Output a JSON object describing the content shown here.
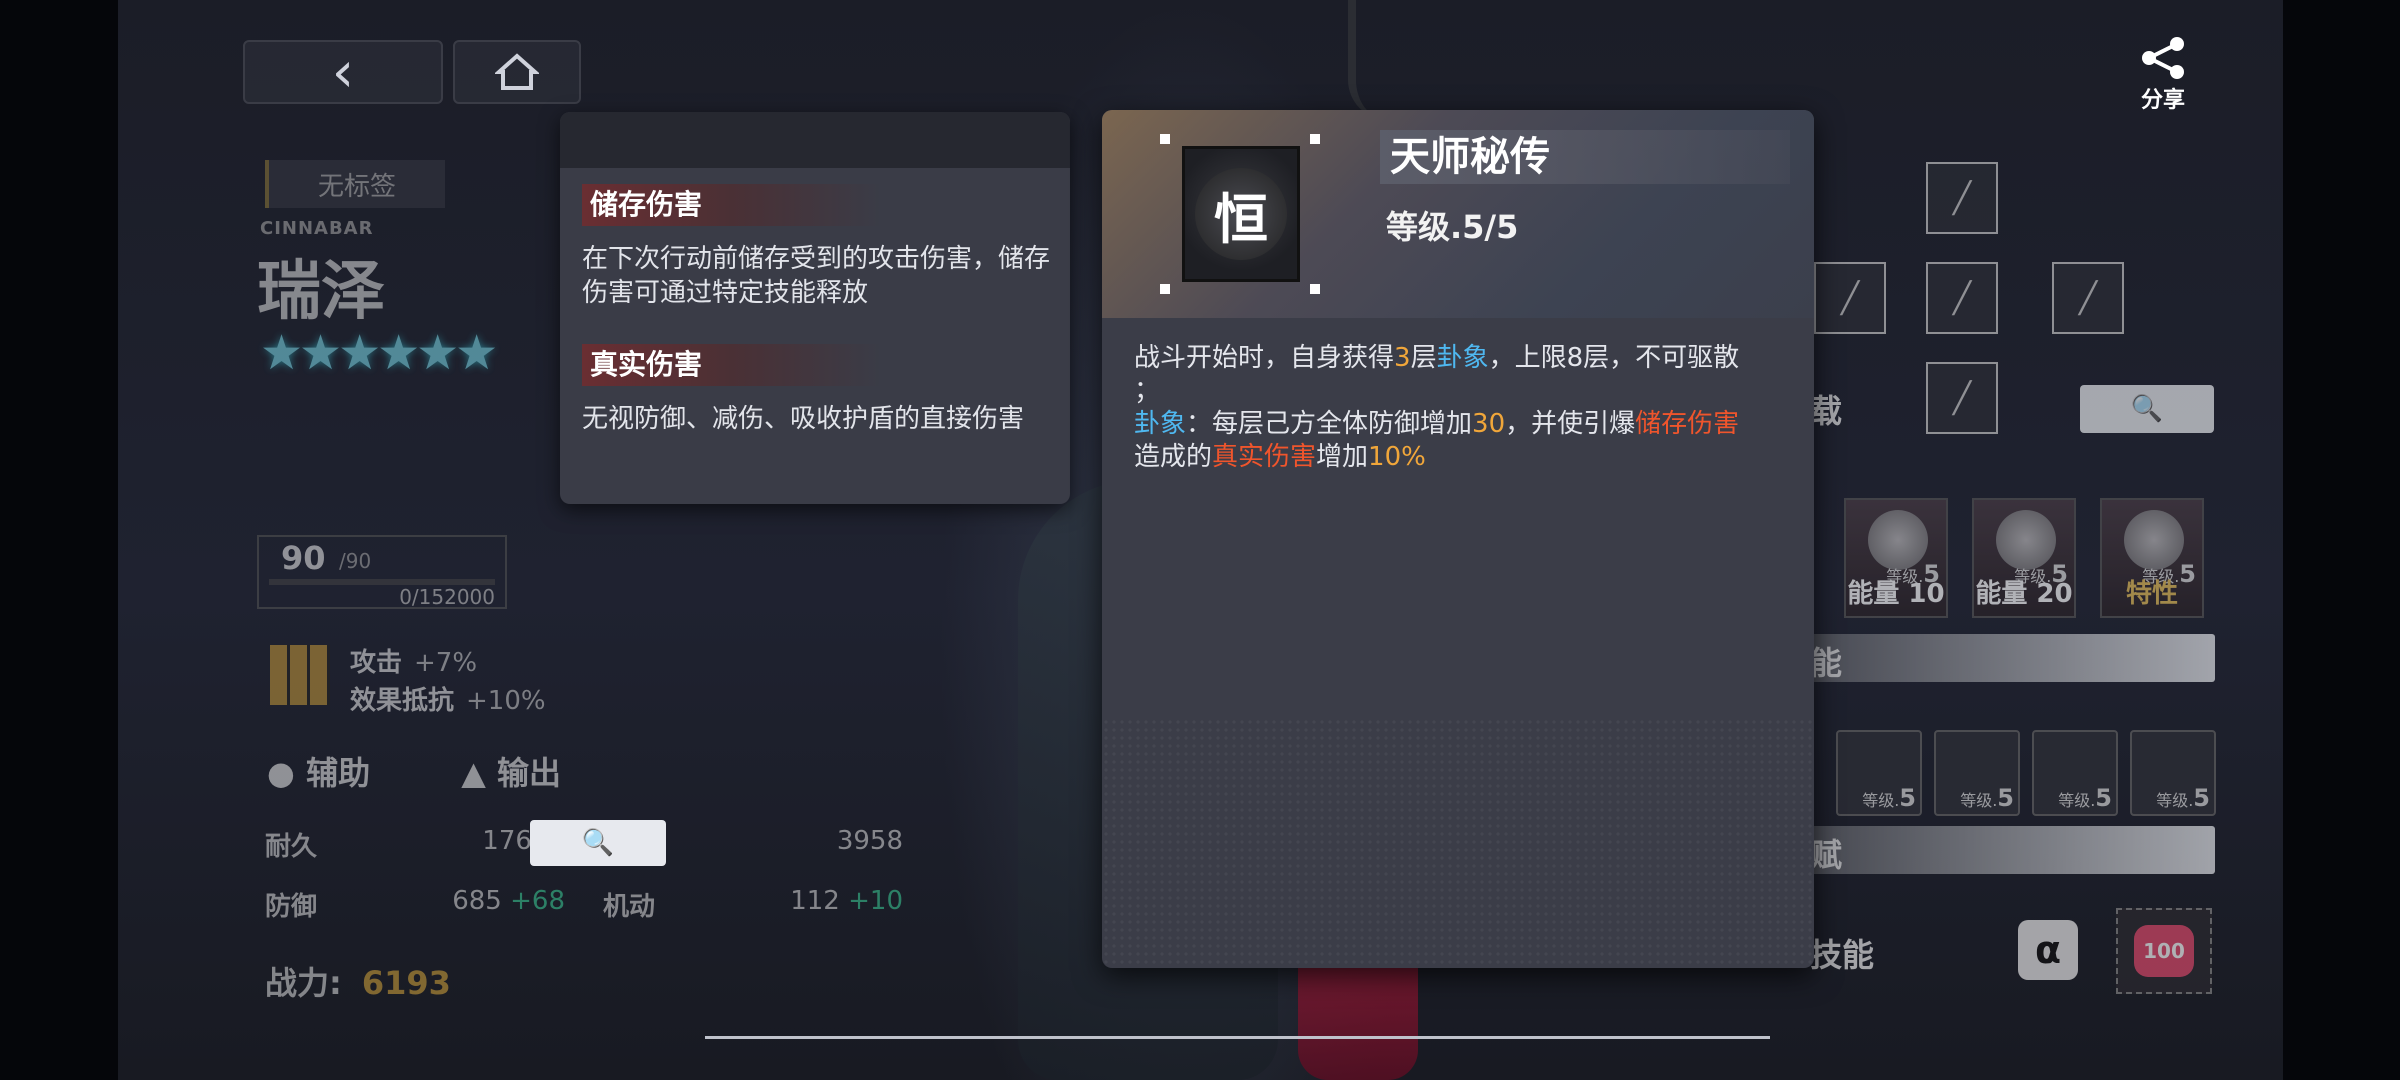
{
  "profile": {
    "tag": "无标签",
    "name_en": "CINNABAR",
    "name_cn": "瑞泽",
    "stars": "★★★★★★",
    "level": "90",
    "level_max": "/90",
    "exp": "0/152000",
    "bonus_1_label": "攻击",
    "bonus_1_value": "+7%",
    "bonus_2_label": "效果抵抗",
    "bonus_2_value": "+10%",
    "role_1": "辅助",
    "role_2": "输出",
    "stats": {
      "hp_label": "耐久",
      "hp_value": "17618",
      "atk_label": "攻击",
      "atk_value": "3958",
      "def_label": "防御",
      "def_value": "685",
      "def_plus": "+68",
      "mob_label": "机动",
      "mob_value": "112",
      "mob_plus": "+10"
    },
    "power_label": "战力:",
    "power_value": "6193"
  },
  "share_label": "分享",
  "glossary": {
    "terms": [
      {
        "title": "储存伤害",
        "desc": "在下次行动前储存受到的攻击伤害，储存伤害可通过特定技能释放"
      },
      {
        "title": "真实伤害",
        "desc": "无视防御、减伤、吸收护盾的直接伤害"
      }
    ]
  },
  "skill_detail": {
    "title": "天师秘传",
    "level": "等级.5/5",
    "icon": "tianshi-emblem-icon",
    "line1_a": "战斗开始时，自身获得",
    "line1_b": "3",
    "line1_c": "层",
    "line1_d": "卦象",
    "line1_e": "，上限8层，不可驱散",
    "line1_f": "；",
    "line2_a": "卦象",
    "line2_b": "：每层己方全体防御增加",
    "line2_c": "30",
    "line2_d": "，并使引爆",
    "line2_e": "储存伤害",
    "line2_f": "造成的",
    "line2_g": "真实伤害",
    "line2_h": "增加",
    "line2_i": "10%"
  },
  "right_panel": {
    "section_1": "载",
    "section_2": "能",
    "section_3": "赋",
    "section_4": "技能",
    "skill_cards": [
      {
        "lvl_prefix": "等级.",
        "lvl": "5",
        "caption": "能量 10"
      },
      {
        "lvl_prefix": "等级.",
        "lvl": "5",
        "caption": "能量 20"
      },
      {
        "lvl_prefix": "等级.",
        "lvl": "5",
        "caption": "特性"
      }
    ],
    "talents": [
      {
        "lvl_prefix": "等级.",
        "lvl": "5"
      },
      {
        "lvl_prefix": "等级.",
        "lvl": "5"
      },
      {
        "lvl_prefix": "等级.",
        "lvl": "5"
      },
      {
        "lvl_prefix": "等级.",
        "lvl": "5"
      }
    ],
    "alpha": "α",
    "heart_value": "100",
    "partial_level": "5"
  },
  "colors": {
    "accent_orange": "#f0a63a",
    "accent_blue": "#4fb8f0",
    "accent_red": "#f0552c",
    "power_gold": "#d6a63c"
  }
}
